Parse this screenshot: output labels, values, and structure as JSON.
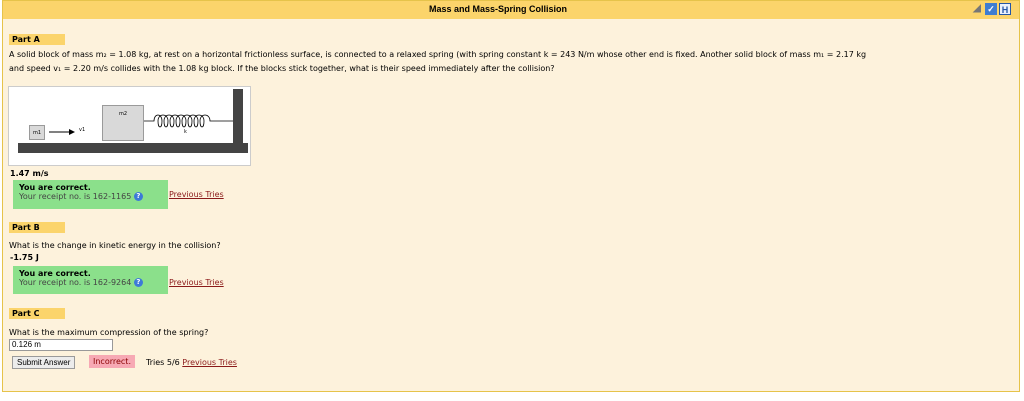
{
  "window": {
    "title": "Mass and Mass-Spring Collision"
  },
  "toolbar_icons": [
    "resize-icon",
    "check-icon",
    "h-icon"
  ],
  "partA": {
    "header": "Part A",
    "question_line1": "A solid block of mass m₂ = 1.08 kg, at rest on a horizontal frictionless surface, is connected to a relaxed spring (with spring constant k = 243 N/m whose other end is fixed. Another solid block of mass m₁ = 2.17 kg",
    "question_line2": "and speed v₁ = 2.20 m/s collides with the 1.08 kg block. If the blocks stick together, what is their speed immediately after the collision?",
    "figure": {
      "m1_label": "m1",
      "v1_label": "v1",
      "m2_label": "m2",
      "k_label": "k"
    },
    "answer": "1.47 m/s",
    "status": "You are correct.",
    "receipt": "Your receipt no. is 162-1165",
    "previous_tries": "Previous Tries"
  },
  "partB": {
    "header": "Part B",
    "question": "What is the change in kinetic energy in the collision?",
    "answer": "-1.75 J",
    "status": "You are correct.",
    "receipt": "Your receipt no. is 162-9264",
    "previous_tries": "Previous Tries"
  },
  "partC": {
    "header": "Part C",
    "question": "What is the maximum compression of the spring?",
    "input_value": "0.126 m",
    "submit_label": "Submit Answer",
    "status": "Incorrect.",
    "tries": "Tries 5/6",
    "previous_tries": "Previous Tries"
  }
}
